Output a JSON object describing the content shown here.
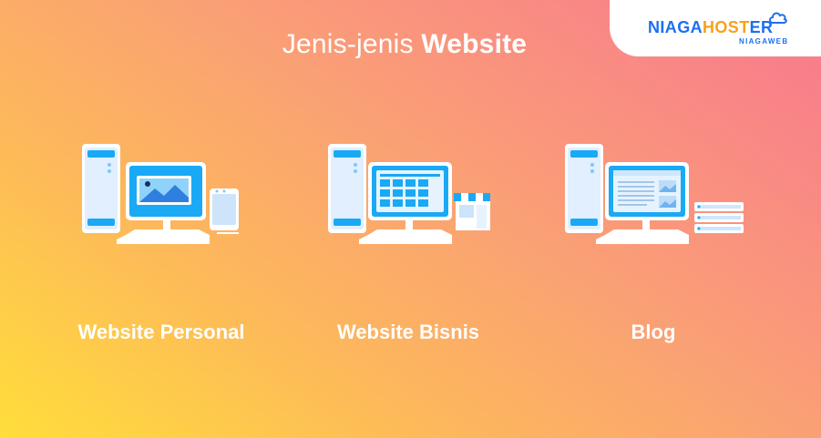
{
  "header": {
    "title_light": "Jenis-jenis",
    "title_bold": "Website"
  },
  "logo": {
    "name_part1": "NIAGA",
    "name_part2": "HOST",
    "name_part3": "ER",
    "sub": "NIAGAWEB",
    "icon": "cloud-icon"
  },
  "items": [
    {
      "label": "Website Personal",
      "icon": "personal-website-computer-icon"
    },
    {
      "label": "Website Bisnis",
      "icon": "business-website-computer-icon"
    },
    {
      "label": "Blog",
      "icon": "blog-computer-icon"
    }
  ],
  "colors": {
    "gradient_start": "#ffde3a",
    "gradient_end": "#f8788f",
    "brand_blue": "#1d6ff0",
    "brand_orange": "#f7a21b",
    "screen_blue": "#1aa9f5"
  }
}
